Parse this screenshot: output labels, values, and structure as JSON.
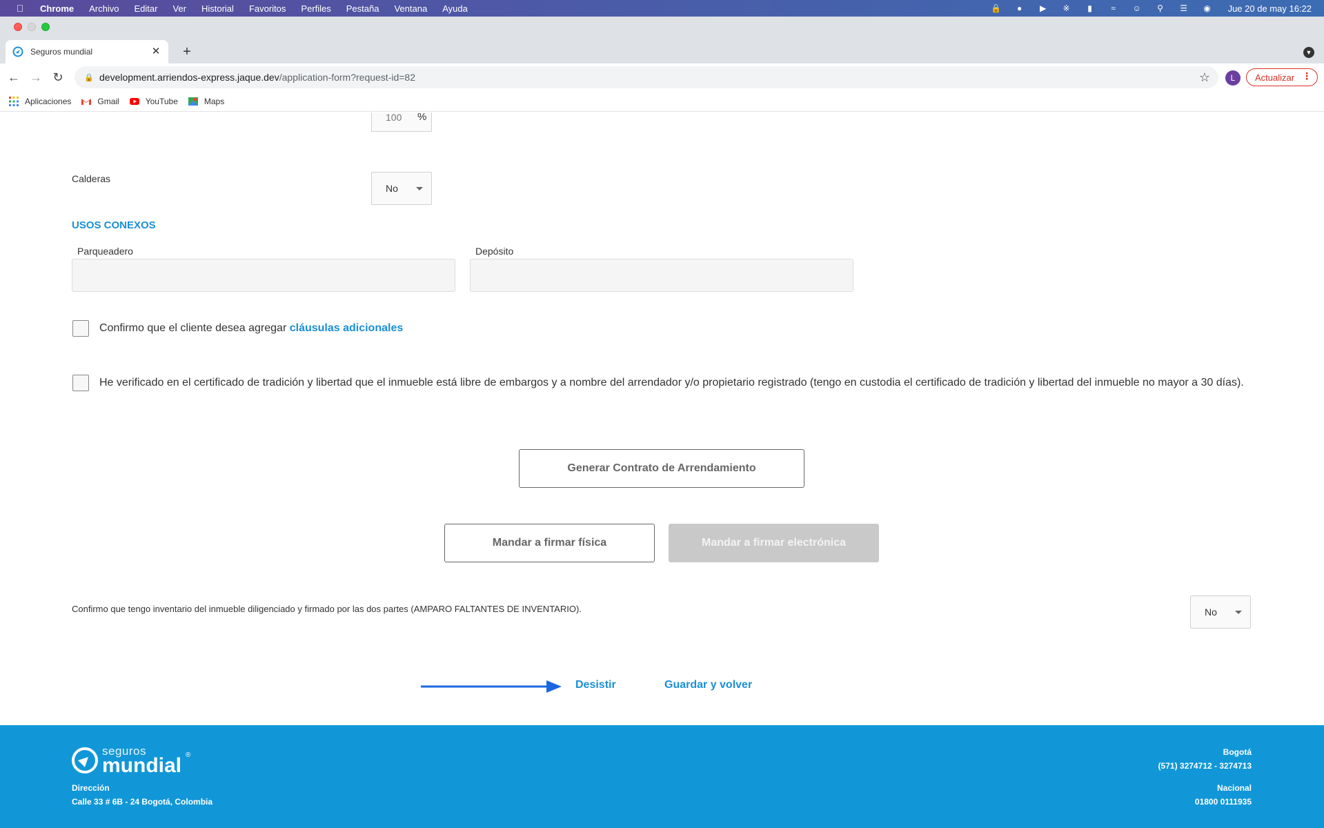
{
  "menubar": {
    "app": "Chrome",
    "items": [
      "Archivo",
      "Editar",
      "Ver",
      "Historial",
      "Favoritos",
      "Perfiles",
      "Pestaña",
      "Ventana",
      "Ayuda"
    ],
    "clock": "Jue 20 de may  16:22"
  },
  "browser": {
    "tab_title": "Seguros mundial",
    "url_host": "development.arriendos-express.jaque.dev",
    "url_path": "/application-form?request-id=82",
    "avatar_letter": "L",
    "update_label": "Actualizar",
    "bookmarks": [
      "Aplicaciones",
      "Gmail",
      "YouTube",
      "Maps"
    ]
  },
  "form": {
    "percent_value": "100",
    "percent_unit": "%",
    "calderas_label": "Calderas",
    "calderas_value": "No",
    "usos_title": "USOS CONEXOS",
    "parqueadero_label": "Parqueadero",
    "deposito_label": "Depósito",
    "check1_text": "Confirmo que el cliente desea agregar ",
    "check1_link": "cláusulas adicionales",
    "check2_text": "He verificado en el certificado de tradición y libertad que el inmueble está libre de embargos y a nombre del arrendador y/o propietario registrado (tengo en custodia el certificado de tradición y libertad del inmueble no mayor a 30 días).",
    "generate_button": "Generar Contrato de Arrendamiento",
    "sign_physical_button": "Mandar a firmar física",
    "sign_electronic_button": "Mandar a firmar electrónica",
    "inventory_text": "Confirmo que tengo inventario del inmueble diligenciado y firmado por las dos partes (AMPARO FALTANTES DE INVENTARIO).",
    "inventory_value": "No",
    "desist_link": "Desistir",
    "save_link": "Guardar y volver"
  },
  "footer": {
    "brand_top": "seguros",
    "brand_main": "mundial",
    "reg": "®",
    "address_label": "Dirección",
    "address": "Calle 33 # 6B - 24 Bogotá, Colombia",
    "city_label": "Bogotá",
    "city_phone": "(571) 3274712 - 3274713",
    "national_label": "Nacional",
    "national_phone": "01800 0111935"
  },
  "colors": {
    "accent": "#1a8fd6",
    "footer_bg": "#1197d8",
    "arrow": "#1a66e0"
  }
}
